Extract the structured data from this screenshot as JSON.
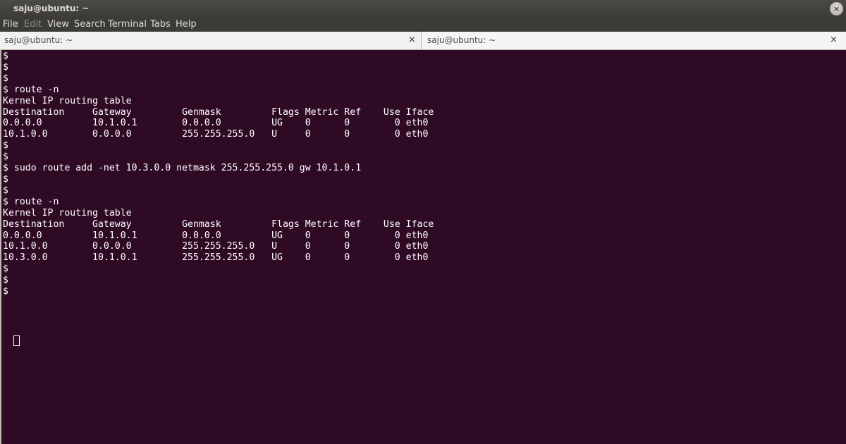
{
  "window": {
    "title": "saju@ubuntu: ~",
    "close_glyph": "×"
  },
  "menubar": {
    "items": [
      {
        "label": "File",
        "enabled": true
      },
      {
        "label": "Edit",
        "enabled": false
      },
      {
        "label": "View",
        "enabled": true
      },
      {
        "label": "Search",
        "enabled": true
      },
      {
        "label": "Terminal",
        "enabled": true
      },
      {
        "label": "Tabs",
        "enabled": true
      },
      {
        "label": "Help",
        "enabled": true
      }
    ]
  },
  "tabs": [
    {
      "label": "saju@ubuntu: ~",
      "close_glyph": "×",
      "active": false
    },
    {
      "label": "saju@ubuntu: ~",
      "close_glyph": "×",
      "active": true
    }
  ],
  "terminal": {
    "lines": [
      "$",
      "$",
      "$",
      "$ route -n",
      "Kernel IP routing table",
      "Destination     Gateway         Genmask         Flags Metric Ref    Use Iface",
      "0.0.0.0         10.1.0.1        0.0.0.0         UG    0      0        0 eth0",
      "10.1.0.0        0.0.0.0         255.255.255.0   U     0      0        0 eth0",
      "$",
      "$",
      "$ sudo route add -net 10.3.0.0 netmask 255.255.255.0 gw 10.1.0.1",
      "$",
      "$",
      "$ route -n",
      "Kernel IP routing table",
      "Destination     Gateway         Genmask         Flags Metric Ref    Use Iface",
      "0.0.0.0         10.1.0.1        0.0.0.0         UG    0      0        0 eth0",
      "10.1.0.0        0.0.0.0         255.255.255.0   U     0      0        0 eth0",
      "10.3.0.0        10.1.0.1        255.255.255.0   UG    0      0        0 eth0",
      "$",
      "$",
      "$"
    ]
  },
  "colors": {
    "terminal_bg": "#2f0a24",
    "terminal_fg": "#ffffff",
    "titlebar_bg": "#3c3b37"
  }
}
